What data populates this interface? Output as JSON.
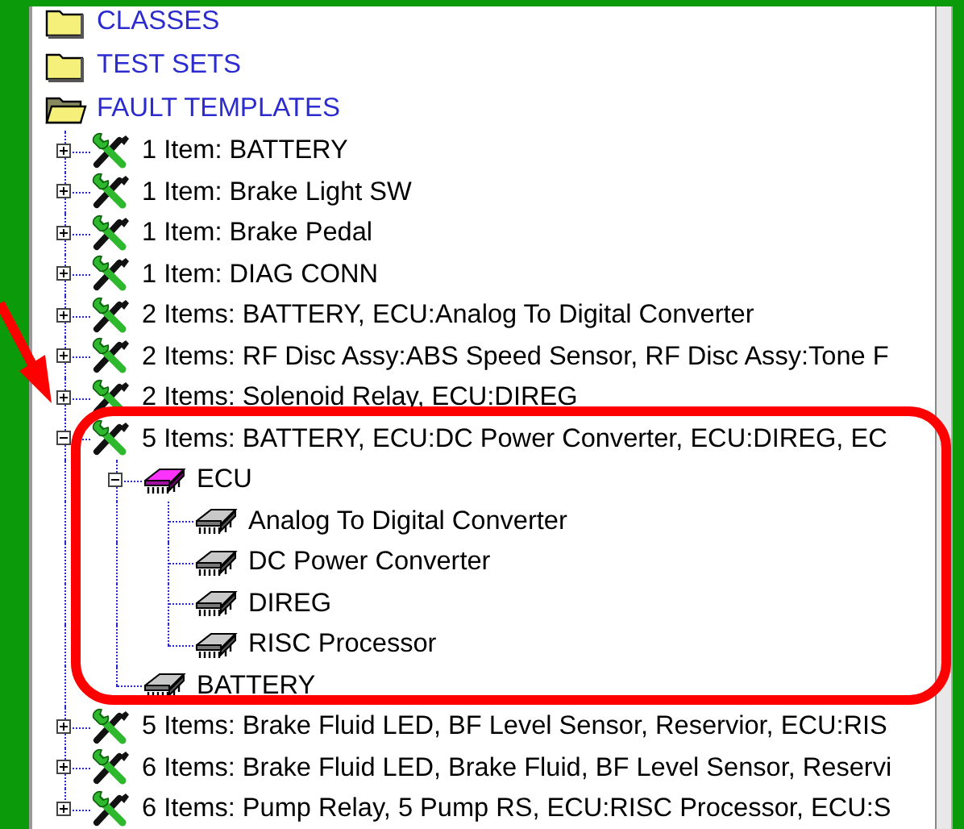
{
  "tree": {
    "items": [
      {
        "kind": "folder",
        "label": "CLASSES",
        "expanded": false
      },
      {
        "kind": "folder",
        "label": "TEST SETS",
        "expanded": false
      },
      {
        "kind": "folder",
        "label": "FAULT TEMPLATES",
        "expanded": true,
        "children": [
          {
            "kind": "fault",
            "label": "1 Item: BATTERY",
            "expanded": false
          },
          {
            "kind": "fault",
            "label": "1 Item: Brake Light SW",
            "expanded": false
          },
          {
            "kind": "fault",
            "label": "1 Item: Brake Pedal",
            "expanded": false
          },
          {
            "kind": "fault",
            "label": "1 Item: DIAG CONN",
            "expanded": false
          },
          {
            "kind": "fault",
            "label": "2 Items: BATTERY, ECU:Analog To Digital Converter",
            "expanded": false
          },
          {
            "kind": "fault",
            "label": "2 Items: RF Disc Assy:ABS Speed Sensor, RF Disc Assy:Tone F",
            "expanded": false
          },
          {
            "kind": "fault",
            "label": "2 Items: Solenoid Relay, ECU:DIREG",
            "expanded": false
          },
          {
            "kind": "fault",
            "label": "5 Items: BATTERY, ECU:DC Power Converter, ECU:DIREG, EC",
            "expanded": true,
            "children": [
              {
                "kind": "module",
                "label": "ECU",
                "expanded": true,
                "children": [
                  {
                    "kind": "part",
                    "label": "Analog To Digital Converter"
                  },
                  {
                    "kind": "part",
                    "label": "DC Power Converter"
                  },
                  {
                    "kind": "part",
                    "label": "DIREG"
                  },
                  {
                    "kind": "part",
                    "label": "RISC Processor"
                  }
                ]
              },
              {
                "kind": "part",
                "label": "BATTERY"
              }
            ]
          },
          {
            "kind": "fault",
            "label": "5 Items: Brake Fluid LED, BF Level Sensor, Reservior, ECU:RIS",
            "expanded": false
          },
          {
            "kind": "fault",
            "label": "6 Items: Brake Fluid LED, Brake Fluid, BF Level Sensor, Reservi",
            "expanded": false
          },
          {
            "kind": "fault",
            "label": "6 Items: Pump Relay, 5 Pump RS, ECU:RISC Processor, ECU:S",
            "expanded": false
          }
        ]
      }
    ]
  }
}
